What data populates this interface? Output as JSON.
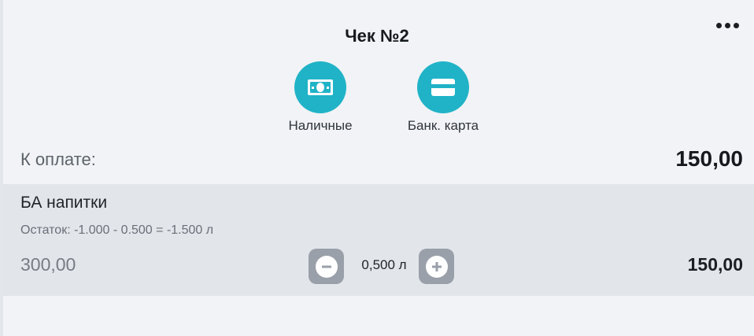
{
  "receipt": {
    "title": "Чек №2"
  },
  "menu": {
    "icon": "more-horizontal-icon"
  },
  "payment_methods": [
    {
      "label": "Наличные",
      "icon": "cash-icon",
      "color": "#20b3c7"
    },
    {
      "label": "Банк. карта",
      "icon": "bank-card-icon",
      "color": "#20b3c7"
    }
  ],
  "summary": {
    "to_pay_label": "К оплате:",
    "to_pay_value": "150,00"
  },
  "items": [
    {
      "name": "БА напитки",
      "remainder": "Остаток: -1.000 - 0.500 = -1.500 л",
      "price": "300,00",
      "quantity": "0,500 л",
      "total": "150,00"
    }
  ],
  "colors": {
    "accent": "#20b3c7",
    "background": "#f1f3f6",
    "item_background": "#e2e5ea",
    "stepper": "#9aa0a9"
  }
}
